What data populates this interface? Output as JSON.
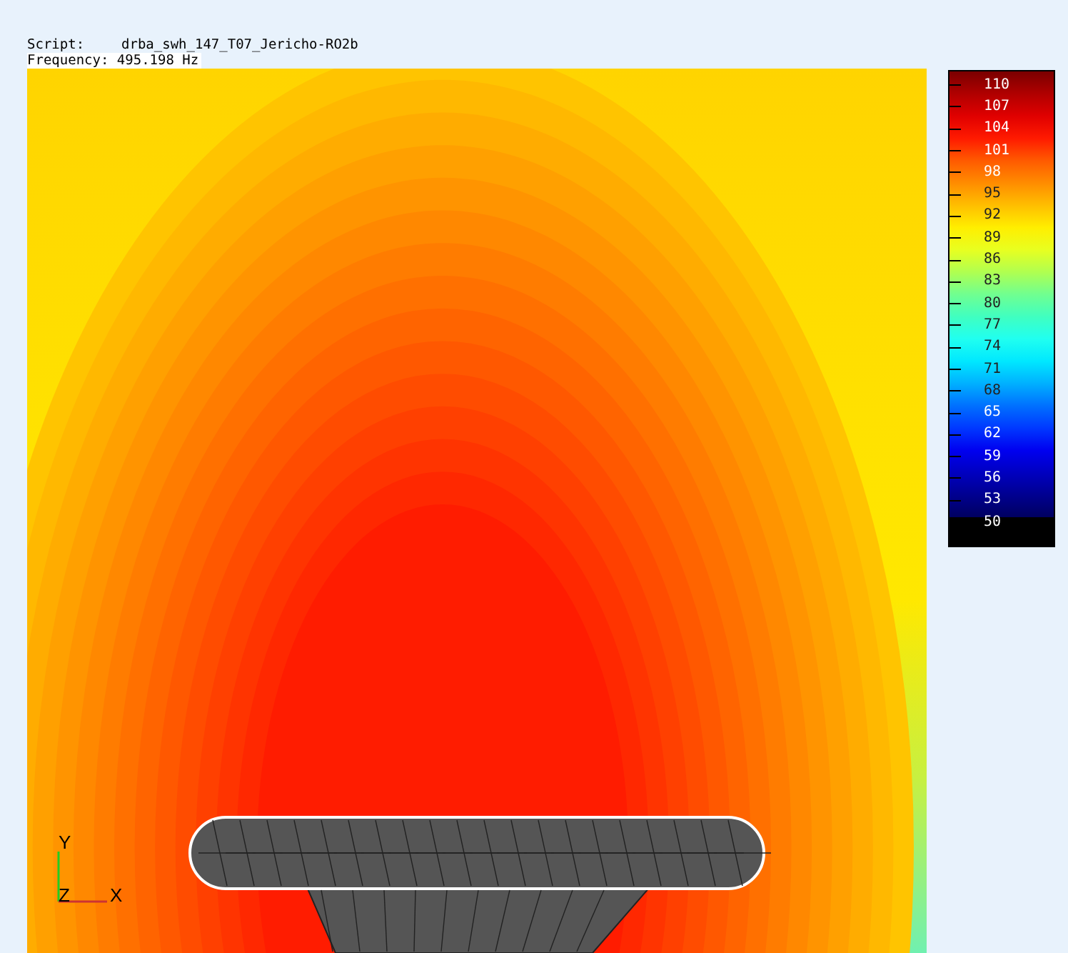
{
  "header": {
    "script_label": "Script:",
    "script_value": "drba_swh_147_T07_Jericho-RO2b",
    "frequency_label": "Frequency:",
    "frequency_value": "495.198 Hz"
  },
  "axes": {
    "y": "Y",
    "z": "Z",
    "x": "X"
  },
  "colorbar": {
    "labels": [
      "110",
      "107",
      "104",
      "101",
      "98",
      "95",
      "92",
      "89",
      "86",
      "83",
      "80",
      "77",
      "74",
      "71",
      "68",
      "65",
      "62",
      "59",
      "56",
      "53",
      "50"
    ]
  }
}
